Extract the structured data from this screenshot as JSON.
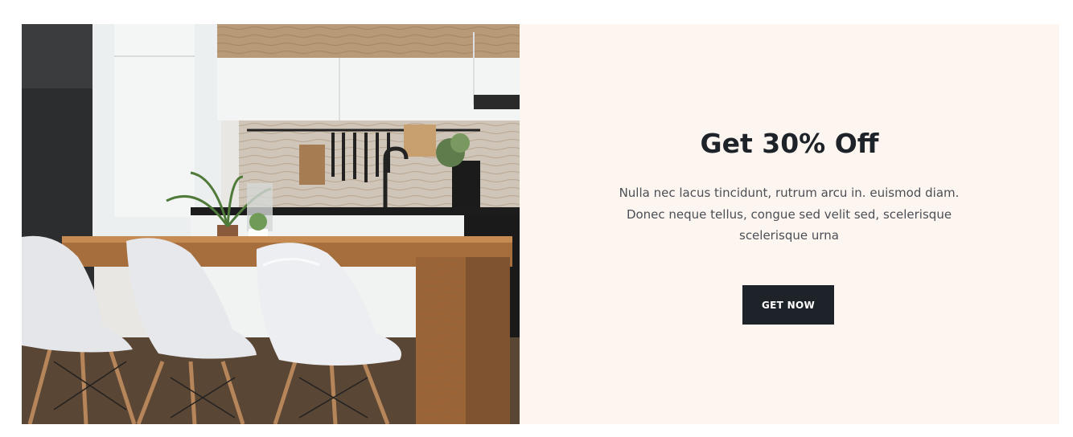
{
  "promo": {
    "image_alt": "Modern kitchen with wooden dining table and white chairs",
    "headline": "Get 30% Off",
    "description": "Nulla nec lacus tincidunt, rutrum arcu in. euismod diam. Donec neque tellus, congue sed velit sed, scelerisque scelerisque urna",
    "cta_label": "GET NOW"
  },
  "colors": {
    "panel_background": "#fdf5f0",
    "button_background": "#1e2329",
    "heading": "#1e2329",
    "body_text": "#4a4f55"
  }
}
